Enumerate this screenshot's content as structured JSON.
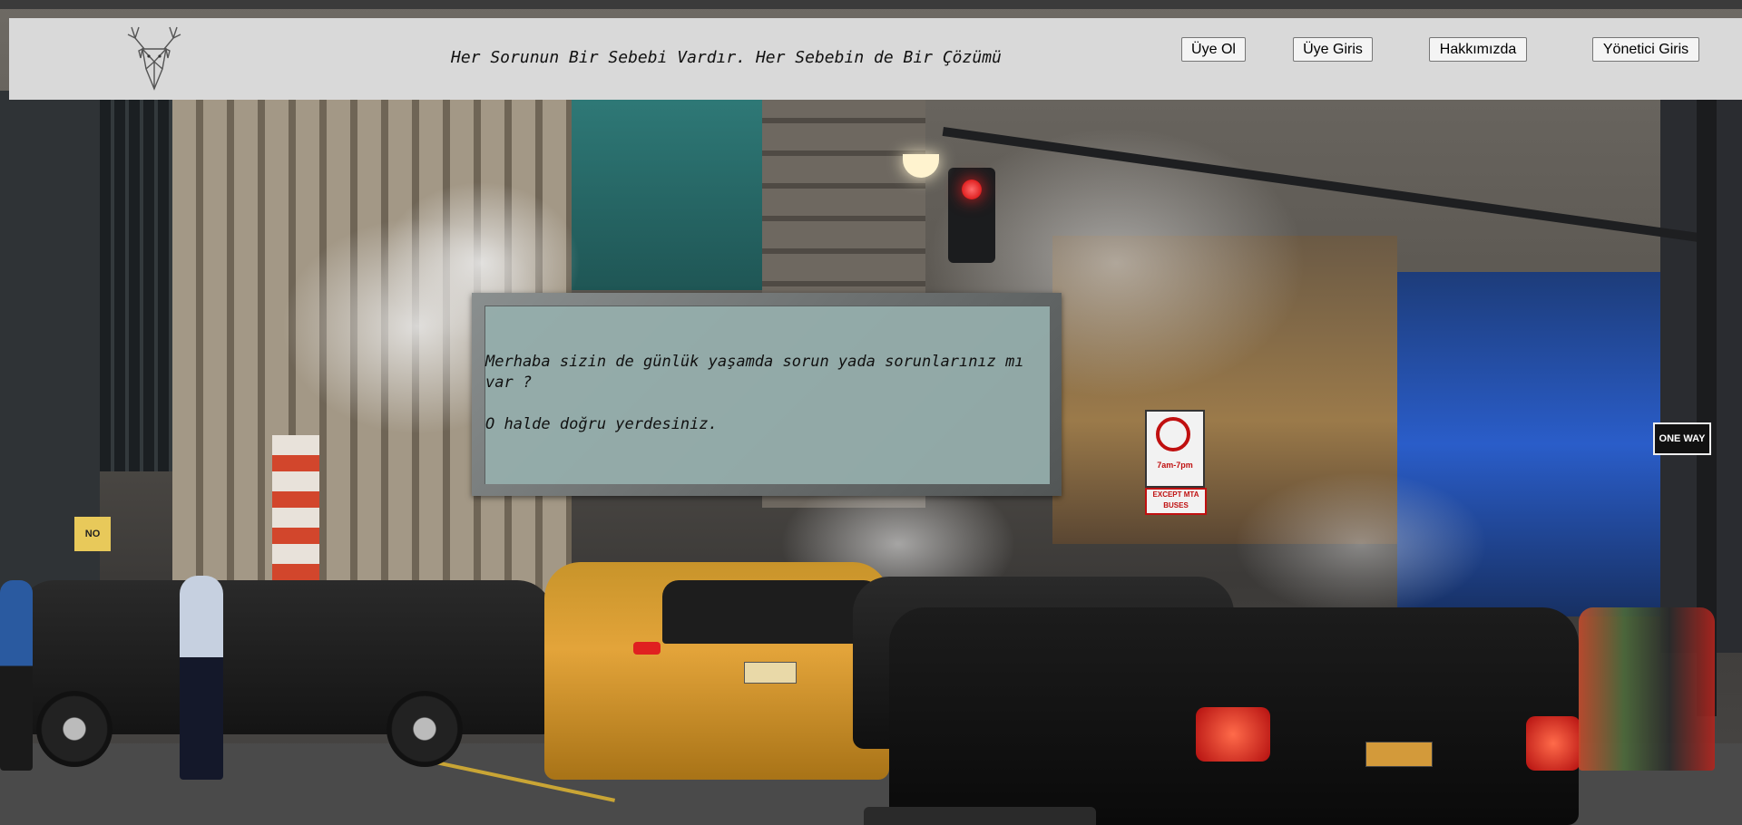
{
  "header": {
    "tagline": "Her Sorunun Bir Sebebi Vardır. Her Sebebin de Bir Çözümü",
    "logo_icon": "deer-head-icon",
    "nav": {
      "register": "Üye Ol",
      "login": "Üye Giris",
      "about": "Hakkımızda",
      "admin_login": "Yönetici Giris"
    }
  },
  "message": {
    "line1": "Merhaba sizin de günlük yaşamda sorun yada sorunlarınız mı var ?",
    "line2": "O halde doğru yerdesiniz."
  },
  "background": {
    "description_icon": "city-street-photo",
    "signs": {
      "no_turn_1": "7am-7pm",
      "except": "EXCEPT MTA BUSES",
      "one_way": "ONE WAY",
      "no": "NO"
    }
  },
  "colors": {
    "header_bg": "#d9d9d9",
    "message_bg": "#96afac",
    "frame": "#6c7070"
  }
}
